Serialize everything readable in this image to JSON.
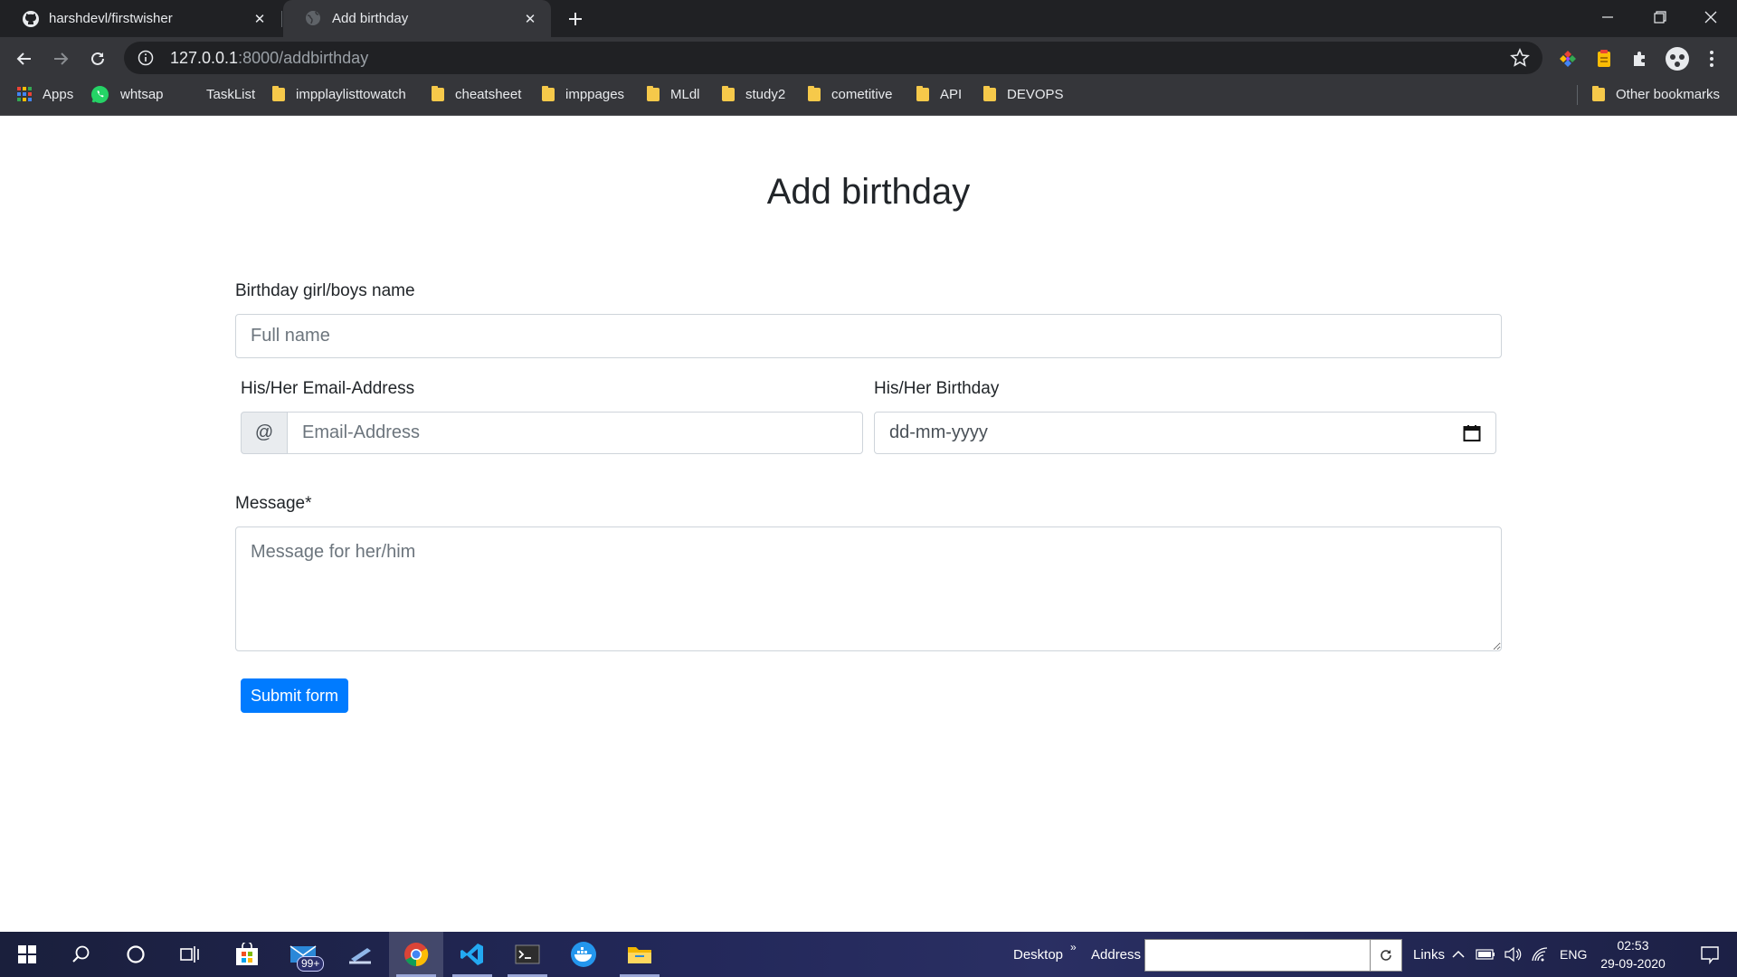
{
  "browser": {
    "tabs": [
      {
        "title": "harshdevl/firstwisher",
        "favicon": "github-icon",
        "active": false
      },
      {
        "title": "Add birthday",
        "favicon": "globe-icon",
        "active": true
      }
    ],
    "address": {
      "host": "127.0.0.1",
      "path": ":8000/addbirthday"
    },
    "bookmarks": [
      {
        "label": "Apps",
        "icon": "apps-grid-icon"
      },
      {
        "label": "whtsap",
        "icon": "whatsapp-icon"
      },
      {
        "label": "TaskList",
        "icon": ""
      },
      {
        "label": "impplaylisttowatch",
        "icon": "folder-icon"
      },
      {
        "label": "cheatsheet",
        "icon": "folder-icon"
      },
      {
        "label": "imppages",
        "icon": "folder-icon"
      },
      {
        "label": "MLdl",
        "icon": "folder-icon"
      },
      {
        "label": "study2",
        "icon": "folder-icon"
      },
      {
        "label": "cometitive",
        "icon": "folder-icon"
      },
      {
        "label": "API",
        "icon": "folder-icon"
      },
      {
        "label": "DEVOPS",
        "icon": "folder-icon"
      }
    ],
    "other_bookmarks": "Other bookmarks"
  },
  "form": {
    "title": "Add birthday",
    "name_label": "Birthday girl/boys name",
    "name_placeholder": "Full name",
    "email_label": "His/Her Email-Address",
    "email_prefix": "@",
    "email_placeholder": "Email-Address",
    "birthday_label": "His/Her Birthday",
    "birthday_placeholder": "dd-mm-yyyy",
    "message_label": "Message*",
    "message_placeholder": "Message for her/him",
    "submit_label": "Submit form"
  },
  "taskbar": {
    "mail_badge": "99+",
    "desktop_label": "Desktop",
    "address_label": "Address",
    "links_label": "Links",
    "language": "ENG",
    "time": "02:53",
    "date": "29-09-2020"
  },
  "colors": {
    "primary_button": "#007bff",
    "chrome_dark": "#202124",
    "chrome_toolbar": "#35363a"
  }
}
